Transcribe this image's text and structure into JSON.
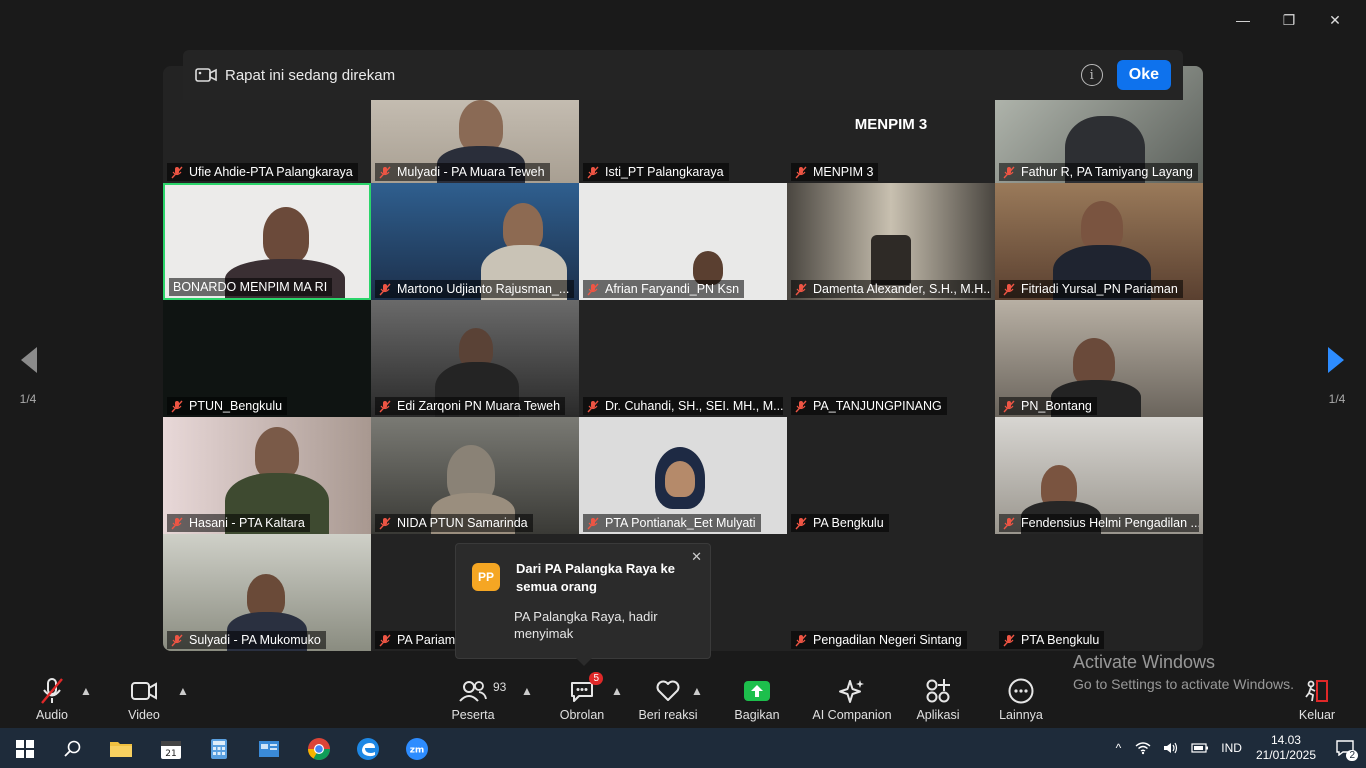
{
  "window": {
    "minimize": "—",
    "restore": "❐",
    "close": "✕"
  },
  "recording": {
    "message": "Rapat ini sedang direkam",
    "info_glyph": "i",
    "ok_label": "Oke"
  },
  "tiles": [
    {
      "name": "Ufie Ahdie-PTA Palangkaraya"
    },
    {
      "name": "Mulyadi - PA Muara Teweh"
    },
    {
      "name": "Isti_PT Palangkaraya"
    },
    {
      "name": "MENPIM 3",
      "big": "MENPIM 3"
    },
    {
      "name": "Fathur R, PA Tamiyang Layang"
    },
    {
      "name": "BONARDO MENPIM MA RI"
    },
    {
      "name": "Martono Udjianto Rajusman_..."
    },
    {
      "name": "Afrian Faryandi_PN Ksn"
    },
    {
      "name": "Damenta Alexander, S.H., M.H..."
    },
    {
      "name": "Fitriadi Yursal_PN Pariaman"
    },
    {
      "name": "PTUN_Bengkulu"
    },
    {
      "name": "Edi Zarqoni PN Muara Teweh"
    },
    {
      "name": "Dr. Cuhandi, SH., SEI. MH., M..."
    },
    {
      "name": "PA_TANJUNGPINANG"
    },
    {
      "name": "PN_Bontang"
    },
    {
      "name": "Hasani - PTA Kaltara"
    },
    {
      "name": "NIDA PTUN Samarinda"
    },
    {
      "name": "PTA Pontianak_Eet Mulyati"
    },
    {
      "name": "PA Bengkulu"
    },
    {
      "name": "Fendensius Helmi Pengadilan ..."
    },
    {
      "name": "Sulyadi - PA Mukomuko"
    },
    {
      "name": "PA Pariaman"
    },
    {
      "name": ""
    },
    {
      "name": "Pengadilan Negeri Sintang"
    },
    {
      "name": "PTA Bengkulu"
    }
  ],
  "pagination": {
    "prev": "1/4",
    "next": "1/4"
  },
  "chat_toast": {
    "avatar": "PP",
    "title": "Dari PA Palangka Raya ke semua orang",
    "message": "PA Palangka Raya, hadir menyimak",
    "close": "✕"
  },
  "toolbar": {
    "audio": "Audio",
    "video": "Video",
    "participants": "Peserta",
    "participants_count": "93",
    "chat": "Obrolan",
    "chat_badge": "5",
    "reactions": "Beri reaksi",
    "share": "Bagikan",
    "ai": "AI Companion",
    "apps": "Aplikasi",
    "more": "Lainnya",
    "leave": "Keluar"
  },
  "watermark": {
    "line1": "Activate Windows",
    "line2": "Go to Settings to activate Windows."
  },
  "taskbar": {
    "lang": "IND",
    "time": "14.03",
    "date": "21/01/2025",
    "notif_count": "2"
  }
}
